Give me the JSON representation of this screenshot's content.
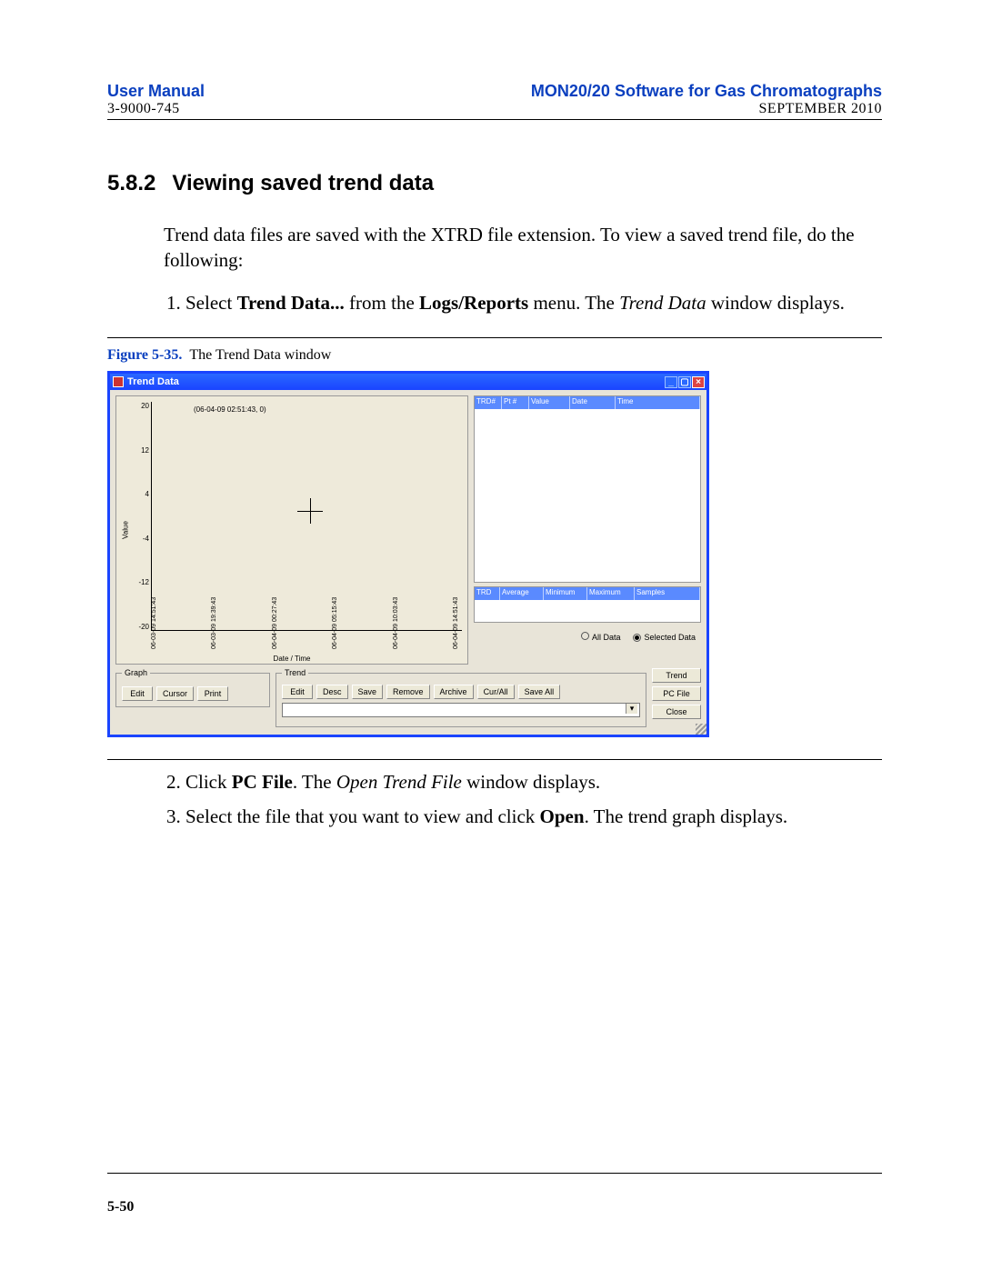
{
  "header": {
    "left_title": "User Manual",
    "left_sub": "3-9000-745",
    "right_title": "MON20/20 Software for Gas Chromatographs",
    "right_sub": "SEPTEMBER 2010"
  },
  "section": {
    "number": "5.8.2",
    "title": "Viewing saved trend data"
  },
  "para_intro": "Trend data files are saved with the XTRD file extension.  To view a saved trend file, do the following:",
  "step1": {
    "prefix": "Select ",
    "bold1": "Trend Data...",
    "mid": " from the ",
    "bold2": "Logs/Reports",
    "after": " menu.  The ",
    "italic": "Trend Data",
    "tail": " window displays."
  },
  "figure": {
    "num": "Figure 5-35.",
    "caption": "The Trend Data window"
  },
  "win": {
    "title": "Trend Data",
    "tooltip": "(06-04-09 02:51:43, 0)",
    "yaxis": "Value",
    "xaxis": "Date / Time",
    "table1_headers": [
      "TRD#",
      "Pt #",
      "Value",
      "Date",
      "Time"
    ],
    "table2_headers": [
      "TRD",
      "Average",
      "Minimum",
      "Maximum",
      "Samples"
    ],
    "radio_all": "All Data",
    "radio_sel": "Selected Data",
    "graph_legend": "Graph",
    "graph_buttons": [
      "Edit",
      "Cursor",
      "Print"
    ],
    "trend_legend": "Trend",
    "trend_buttons": [
      "Edit",
      "Desc",
      "Save",
      "Remove",
      "Archive",
      "Cur/All",
      "Save All"
    ],
    "right_buttons": [
      "Trend",
      "PC File",
      "Close"
    ]
  },
  "chart_data": {
    "type": "line",
    "title": "",
    "xlabel": "Date / Time",
    "ylabel": "Value",
    "ylim": [
      -20,
      20
    ],
    "y_ticks": [
      20,
      12,
      4,
      -4,
      -12,
      -20
    ],
    "x_ticks": [
      "06-03-09 14:51:43",
      "06-03-09 19:39:43",
      "06-04-09 00:27:43",
      "06-04-09 05:15:43",
      "06-04-09 10:03:43",
      "06-04-09 14:51:43"
    ],
    "cursor_point": {
      "x": "06-04-09 02:51:43",
      "y": 0
    },
    "series": []
  },
  "step2": {
    "prefix": "Click ",
    "bold": "PC File",
    "mid": ".  The ",
    "italic": "Open Trend File",
    "tail": " window displays."
  },
  "step3": {
    "prefix": "Select the file that you want to view and click ",
    "bold": "Open",
    "tail": ".  The trend graph displays."
  },
  "page_number": "5-50"
}
